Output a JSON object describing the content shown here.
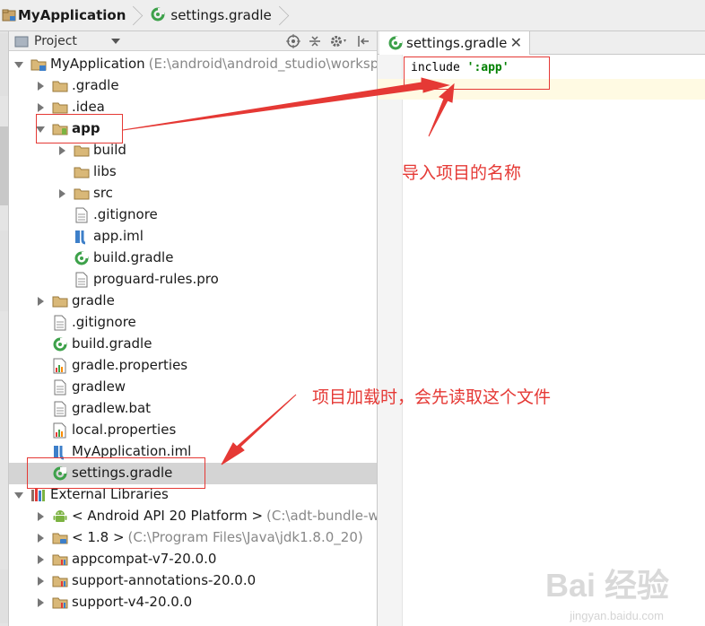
{
  "breadcrumb": {
    "project": "MyApplication",
    "file": "settings.gradle"
  },
  "project_panel": {
    "view_selector": "Project",
    "tree": [
      {
        "label": "MyApplication",
        "path": "(E:\\android\\android_studio\\worksp",
        "icon": "module-icon",
        "bold": true
      },
      {
        "label": ".gradle",
        "icon": "folder-icon"
      },
      {
        "label": ".idea",
        "icon": "folder-icon"
      },
      {
        "label": "app",
        "icon": "android-module-folder-icon",
        "bold": true
      },
      {
        "label": "build",
        "icon": "folder-icon"
      },
      {
        "label": "libs",
        "icon": "folder-icon"
      },
      {
        "label": "src",
        "icon": "folder-icon"
      },
      {
        "label": ".gitignore",
        "icon": "text-file-icon"
      },
      {
        "label": "app.iml",
        "icon": "iml-file-icon"
      },
      {
        "label": "build.gradle",
        "icon": "gradle-file-icon"
      },
      {
        "label": "proguard-rules.pro",
        "icon": "text-file-icon"
      },
      {
        "label": "gradle",
        "icon": "folder-icon"
      },
      {
        "label": ".gitignore",
        "icon": "text-file-icon"
      },
      {
        "label": "build.gradle",
        "icon": "gradle-file-icon"
      },
      {
        "label": "gradle.properties",
        "icon": "properties-file-icon"
      },
      {
        "label": "gradlew",
        "icon": "text-file-icon"
      },
      {
        "label": "gradlew.bat",
        "icon": "text-file-icon"
      },
      {
        "label": "local.properties",
        "icon": "properties-file-icon"
      },
      {
        "label": "MyApplication.iml",
        "icon": "iml-file-icon"
      },
      {
        "label": "settings.gradle",
        "icon": "gradle-file-icon"
      },
      {
        "label": "External Libraries",
        "icon": "library-icon"
      },
      {
        "label": "< Android API 20 Platform >",
        "path": "(C:\\adt-bundle-wi",
        "icon": "android-icon"
      },
      {
        "label": "< 1.8 >",
        "path": "(C:\\Program Files\\Java\\jdk1.8.0_20)",
        "icon": "jdk-folder-icon"
      },
      {
        "label": "appcompat-v7-20.0.0",
        "icon": "library-folder-icon"
      },
      {
        "label": "support-annotations-20.0.0",
        "icon": "library-folder-icon"
      },
      {
        "label": "support-v4-20.0.0",
        "icon": "library-folder-icon"
      }
    ]
  },
  "editor": {
    "tab_label": "settings.gradle",
    "close_glyph": "✕",
    "code_keyword": "include",
    "code_string": "':app'"
  },
  "annotations": {
    "note1": "导入项目的名称",
    "note2": "项目加载时，会先读取这个文件",
    "color": "#e53935"
  },
  "watermark": {
    "brand": "Bai 经验",
    "url": "jingyan.baidu.com"
  }
}
